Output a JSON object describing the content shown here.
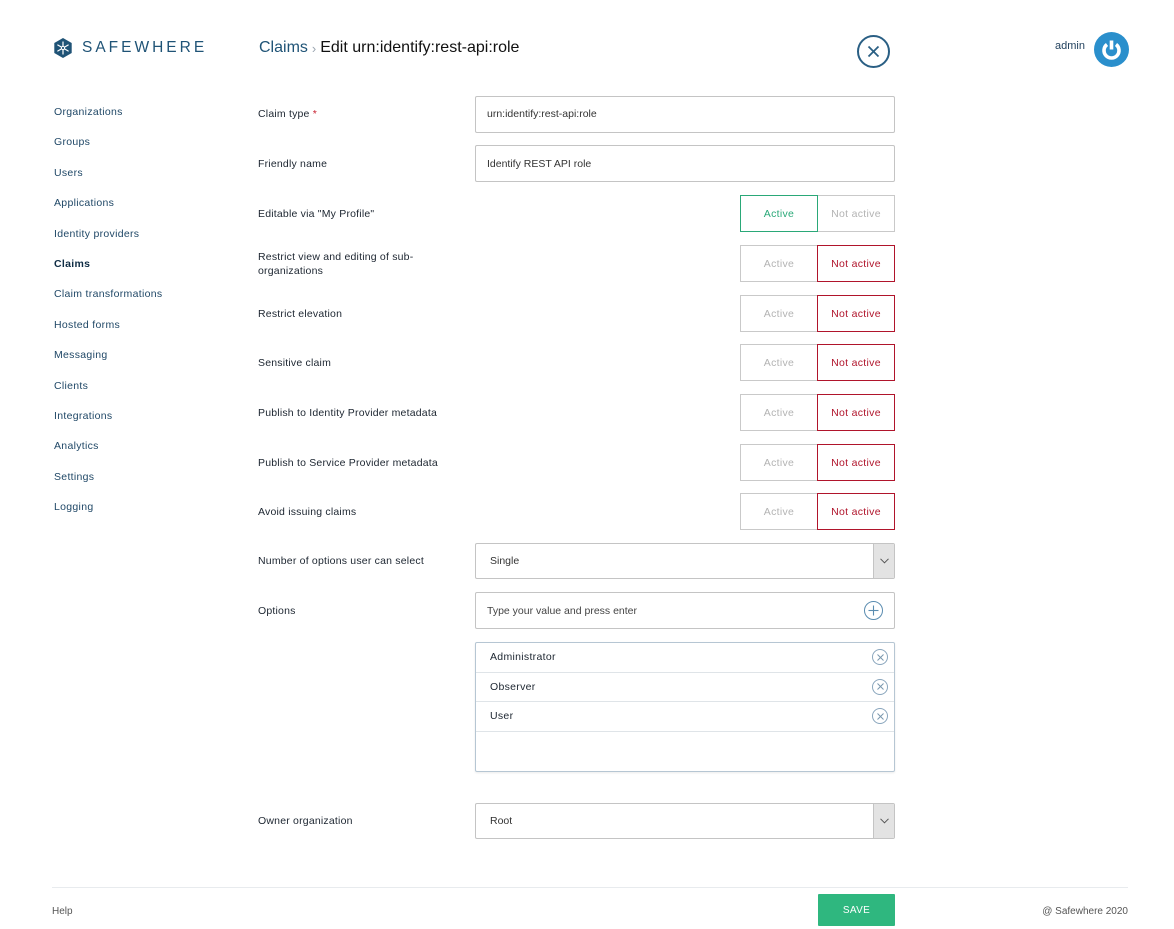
{
  "brand": {
    "name": "SAFEWHERE",
    "logo_icon": "snowflake-hexagon-icon"
  },
  "breadcrumb": {
    "parent": "Claims",
    "separator": "›",
    "current": "Edit urn:identify:rest-api:role"
  },
  "header": {
    "close_icon": "close-circle-icon",
    "user_name": "admin",
    "power_icon": "power-icon"
  },
  "sidebar": {
    "items": [
      {
        "label": "Organizations",
        "active": false
      },
      {
        "label": "Groups",
        "active": false
      },
      {
        "label": "Users",
        "active": false
      },
      {
        "label": "Applications",
        "active": false
      },
      {
        "label": "Identity providers",
        "active": false
      },
      {
        "label": "Claims",
        "active": true
      },
      {
        "label": "Claim transformations",
        "active": false
      },
      {
        "label": "Hosted forms",
        "active": false
      },
      {
        "label": "Messaging",
        "active": false
      },
      {
        "label": "Clients",
        "active": false
      },
      {
        "label": "Integrations",
        "active": false
      },
      {
        "label": "Analytics",
        "active": false
      },
      {
        "label": "Settings",
        "active": false
      },
      {
        "label": "Logging",
        "active": false
      }
    ]
  },
  "form": {
    "claim_type": {
      "label": "Claim type",
      "required_mark": "*",
      "value": "urn:identify:rest-api:role"
    },
    "friendly_name": {
      "label": "Friendly name",
      "value": "Identify REST API role"
    },
    "toggle_labels": {
      "active": "Active",
      "not_active": "Not active"
    },
    "toggles": [
      {
        "label": "Editable via \"My Profile\"",
        "value": "Active"
      },
      {
        "label": "Restrict view and editing of sub-organizations",
        "value": "Not active"
      },
      {
        "label": "Restrict elevation",
        "value": "Not active"
      },
      {
        "label": "Sensitive claim",
        "value": "Not active"
      },
      {
        "label": "Publish to Identity Provider metadata",
        "value": "Not active"
      },
      {
        "label": "Publish to Service Provider metadata",
        "value": "Not active"
      },
      {
        "label": "Avoid issuing claims",
        "value": "Not active"
      }
    ],
    "num_options": {
      "label": "Number of options user can select",
      "value": "Single"
    },
    "options": {
      "label": "Options",
      "placeholder": "Type your value and press enter",
      "items": [
        "Administrator",
        "Observer",
        "User"
      ]
    },
    "owner_org": {
      "label": "Owner organization",
      "value": "Root"
    }
  },
  "footer": {
    "help": "Help",
    "save": "SAVE",
    "copyright": "@ Safewhere 2020"
  },
  "colors": {
    "brand": "#1f5376",
    "active_green": "#2aa878",
    "inactive_red": "#b0142b",
    "save_green": "#2fb77f",
    "power_blue": "#2a8fcc"
  }
}
